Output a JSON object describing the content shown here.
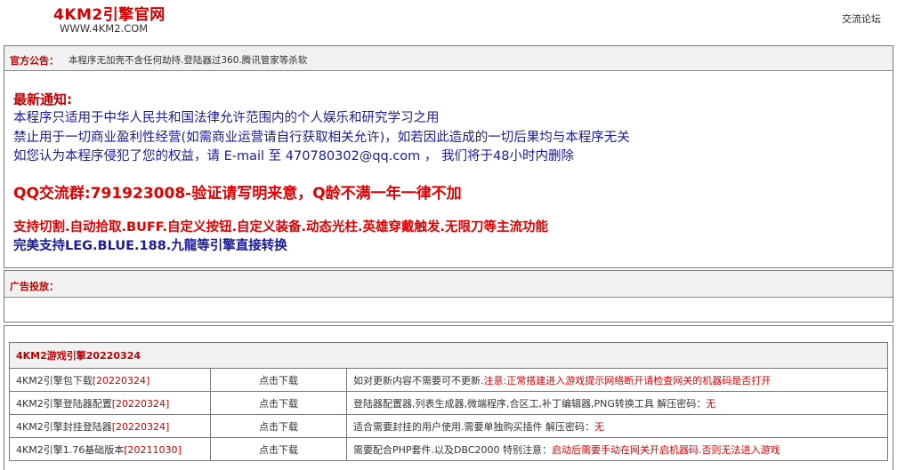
{
  "header": {
    "title": "4KM2引擎官网",
    "subtitle": "WWW.4KM2.COM",
    "forum_link": "交流论坛"
  },
  "announcement": {
    "label": "官方公告：",
    "text": "本程序无加壳不含任何劫持.登陆器过360.腾讯管家等杀软"
  },
  "notice": {
    "heading": "最新通知:",
    "line1": "本程序只适用于中华人民共和国法律允许范围内的个人娱乐和研究学习之用",
    "line2": "禁止用于一切商业盈利性经营(如需商业运营请自行获取相关允许)，如若因此造成的一切后果均与本程序无关",
    "line3": "如您认为本程序侵犯了您的权益，请 E-mail 至 470780302@qq.com ， 我们将于48小时内删除",
    "qq_group": "QQ交流群:791923008-验证请写明来意，Q龄不满一年一律不加",
    "features": "支持切割.自动拾取.BUFF.自定义按钮.自定义装备.动态光柱.英雄穿戴触发.无限刀等主流功能",
    "compat": "完美支持LEG.BLUE.188.九龍等引擎直接转换"
  },
  "ads": {
    "label": "广告投放："
  },
  "downloads": {
    "section_title": "4KM2游戏引擎20220324",
    "rows": [
      {
        "name": "4KM2引擎包下载",
        "date": "[20220324]",
        "link": "点击下载",
        "desc": "如对更新内容不需要可不更新.",
        "note": "注意:正常搭建进入游戏提示网络断开请检查网关的机器码是否打开"
      },
      {
        "name": "4KM2引擎登陆器配置",
        "date": "[20220324]",
        "link": "点击下载",
        "desc": "登陆器配置器,列表生成器,微端程序,合区工,补丁编辑器,PNG转换工具 解压密码：",
        "note": "无"
      },
      {
        "name": "4KM2引擎封挂登陆器",
        "date": "[20220324]",
        "link": "点击下载",
        "desc": "适合需要封挂的用户使用.需要单独购买插件 解压密码：",
        "note": "无"
      },
      {
        "name": "4KM2引擎1.76基础版本",
        "date": "[20211030]",
        "link": "点击下载",
        "desc": "需要配合PHP套件.以及DBC2000 特别注意：",
        "note": "启动后需要手动在网关开启机器码.否则无法进入游戏"
      }
    ]
  }
}
